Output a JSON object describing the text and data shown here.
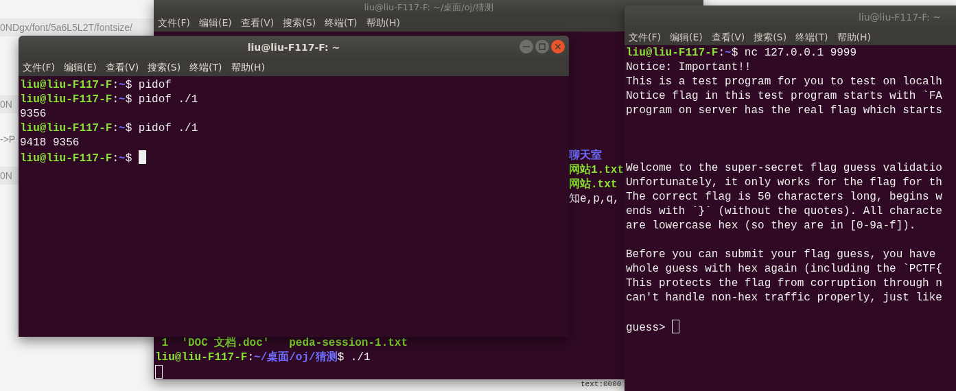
{
  "background_page": {
    "fragments": [
      "0NDgx/font/5a6L5L2T/fontsize/",
      "0N",
      "->P",
      "0N",
      "text:0000"
    ]
  },
  "windows": [
    {
      "title": "liu@liu-F117-F: ~/桌面/oj/猜测",
      "focused": false,
      "has_controls": false,
      "menu": [
        "文件(F)",
        "编辑(E)",
        "查看(V)",
        "搜索(S)",
        "终端(T)",
        "帮助(H)"
      ],
      "partial_lines": [
        {
          "kind": "dir",
          "text": "聊天室"
        },
        {
          "kind": "exec",
          "text": "网站1.txt"
        },
        {
          "kind": "exec",
          "text": "网站.txt"
        },
        {
          "kind": "plain",
          "text": "知e,p,q,"
        }
      ],
      "lines": [
        {
          "kind": "exec",
          "text": " 1  'DOC 文档.doc'   peda-session-1.txt"
        },
        {
          "kind": "prompt",
          "user": "liu@liu-F117-F",
          "sep": ":",
          "path": "~/桌面/oj/猜测",
          "sigil": "$",
          "command": "./1"
        },
        {
          "kind": "cursor"
        }
      ]
    },
    {
      "title": "liu@liu-F117-F: ~",
      "focused": true,
      "has_controls": true,
      "menu": [
        "文件(F)",
        "编辑(E)",
        "查看(V)",
        "搜索(S)",
        "终端(T)",
        "帮助(H)"
      ],
      "lines": [
        {
          "kind": "prompt",
          "user": "liu@liu-F117-F",
          "sep": ":",
          "path": "~",
          "sigil": "$",
          "command": "pidof"
        },
        {
          "kind": "prompt",
          "user": "liu@liu-F117-F",
          "sep": ":",
          "path": "~",
          "sigil": "$",
          "command": "pidof ./1"
        },
        {
          "kind": "plain",
          "text": "9356"
        },
        {
          "kind": "prompt",
          "user": "liu@liu-F117-F",
          "sep": ":",
          "path": "~",
          "sigil": "$",
          "command": "pidof ./1"
        },
        {
          "kind": "plain",
          "text": "9418 9356"
        },
        {
          "kind": "prompt",
          "user": "liu@liu-F117-F",
          "sep": ":",
          "path": "~",
          "sigil": "$"
        },
        {
          "kind": "cursor_inline"
        }
      ]
    },
    {
      "title": "liu@liu-F117-F: ~",
      "focused": false,
      "has_controls": false,
      "menu": [
        "文件(F)",
        "编辑(E)",
        "查看(V)",
        "搜索(S)",
        "终端(T)",
        "帮助(H)"
      ],
      "lines": [
        {
          "kind": "prompt",
          "user": "liu@liu-F117-F",
          "sep": ":",
          "path": "~",
          "sigil": "$",
          "command": "nc 127.0.0.1 9999"
        },
        {
          "kind": "plain",
          "text": "Notice: Important!!"
        },
        {
          "kind": "plain",
          "text": "This is a test program for you to test on localh"
        },
        {
          "kind": "plain",
          "text": "Notice flag in this test program starts with `FA"
        },
        {
          "kind": "plain",
          "text": "program on server has the real flag which starts"
        },
        {
          "kind": "blank"
        },
        {
          "kind": "blank"
        },
        {
          "kind": "blank"
        },
        {
          "kind": "plain",
          "text": "Welcome to the super-secret flag guess validatio"
        },
        {
          "kind": "plain",
          "text": "Unfortunately, it only works for the flag for th"
        },
        {
          "kind": "plain",
          "text": "The correct flag is 50 characters long, begins w"
        },
        {
          "kind": "plain",
          "text": "ends with `}` (without the quotes). All characte"
        },
        {
          "kind": "plain",
          "text": "are lowercase hex (so they are in [0-9a-f])."
        },
        {
          "kind": "blank"
        },
        {
          "kind": "plain",
          "text": "Before you can submit your flag guess, you have"
        },
        {
          "kind": "plain",
          "text": "whole guess with hex again (including the `PCTF{"
        },
        {
          "kind": "plain",
          "text": "This protects the flag from corruption through n"
        },
        {
          "kind": "plain",
          "text": "can't handle non-hex traffic properly, just like"
        },
        {
          "kind": "blank"
        },
        {
          "kind": "input",
          "text": "guess>"
        }
      ]
    }
  ]
}
